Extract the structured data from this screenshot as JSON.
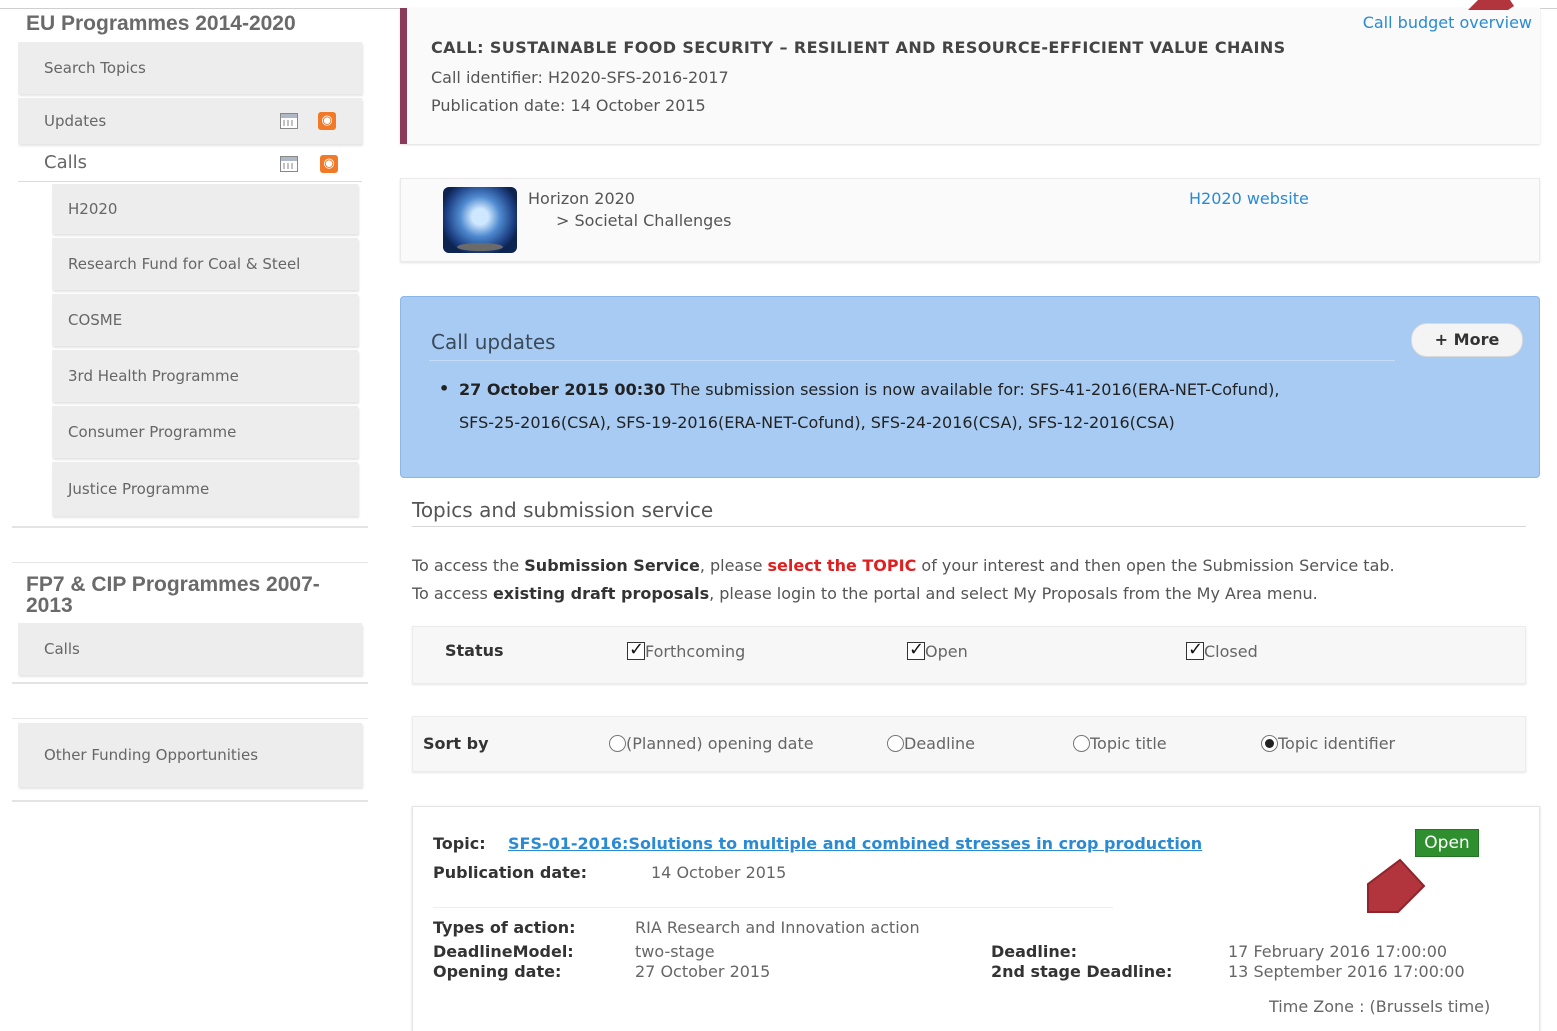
{
  "sidebar": {
    "eu_title": "EU Programmes 2014-2020",
    "search_topics": "Search Topics",
    "updates": "Updates",
    "calls": "Calls",
    "sub_items": [
      "H2020",
      "Research Fund for Coal & Steel",
      "COSME",
      "3rd Health Programme",
      "Consumer Programme",
      "Justice Programme"
    ],
    "fp7_title_line1": "FP7 & CIP Programmes 2007-",
    "fp7_title_line2": "2013",
    "fp7_calls": "Calls",
    "other_funding": "Other Funding Opportunities"
  },
  "call": {
    "budget_link": "Call budget overview",
    "title": "CALL: SUSTAINABLE FOOD SECURITY – RESILIENT AND RESOURCE-EFFICIENT VALUE CHAINS",
    "identifier": "Call identifier: H2020-SFS-2016-2017",
    "publication": "Publication date: 14 October 2015"
  },
  "programme": {
    "name": "Horizon 2020",
    "sub": "> Societal Challenges",
    "website_link": "H2020 website"
  },
  "updates": {
    "title": "Call updates",
    "more_button": "+ More",
    "date": "27 October 2015 00:30",
    "text_line1": "The submission session is now available for: SFS-41-2016(ERA-NET-Cofund),",
    "text_line2": "SFS-25-2016(CSA), SFS-19-2016(ERA-NET-Cofund), SFS-24-2016(CSA), SFS-12-2016(CSA)"
  },
  "topics_section": {
    "heading": "Topics and submission service",
    "p1_a": "To access the ",
    "p1_b": "Submission Service",
    "p1_c": ", please ",
    "p1_d": "select the TOPIC",
    "p1_e": " of your interest and then open the Submission Service tab.",
    "p2_a": "To access ",
    "p2_b": "existing draft proposals",
    "p2_c": ", please login to the portal and select My Proposals from the My Area menu."
  },
  "status_filter": {
    "label": "Status",
    "options": [
      "Forthcoming",
      "Open",
      "Closed"
    ]
  },
  "sort_filter": {
    "label": "Sort by",
    "options": [
      "(Planned) opening date",
      "Deadline",
      "Topic title",
      "Topic identifier"
    ],
    "selected": "Topic identifier"
  },
  "topic": {
    "label": "Topic:",
    "link": "SFS-01-2016:Solutions to multiple and combined stresses in crop production",
    "status_badge": "Open",
    "publication_label": "Publication date:",
    "publication_value": "14 October 2015",
    "types_label": "Types of action:",
    "types_value": "RIA Research and Innovation action",
    "deadline_model_label": "DeadlineModel:",
    "deadline_model_value": "two-stage",
    "opening_label": "Opening date:",
    "opening_value": "27 October 2015",
    "deadline_label": "Deadline:",
    "deadline_value": "17 February 2016 17:00:00",
    "stage2_label": "2nd stage Deadline:",
    "stage2_value": "13 September 2016 17:00:00",
    "timezone": "Time Zone : (Brussels time)"
  },
  "colors": {
    "accent_bar": "#8c3a5c",
    "link": "#2a8ad4",
    "updates_bg": "#a7cbf2",
    "open_badge": "#2f8f2f",
    "highlight_red": "#e02020",
    "pointer": "#b2343c"
  }
}
